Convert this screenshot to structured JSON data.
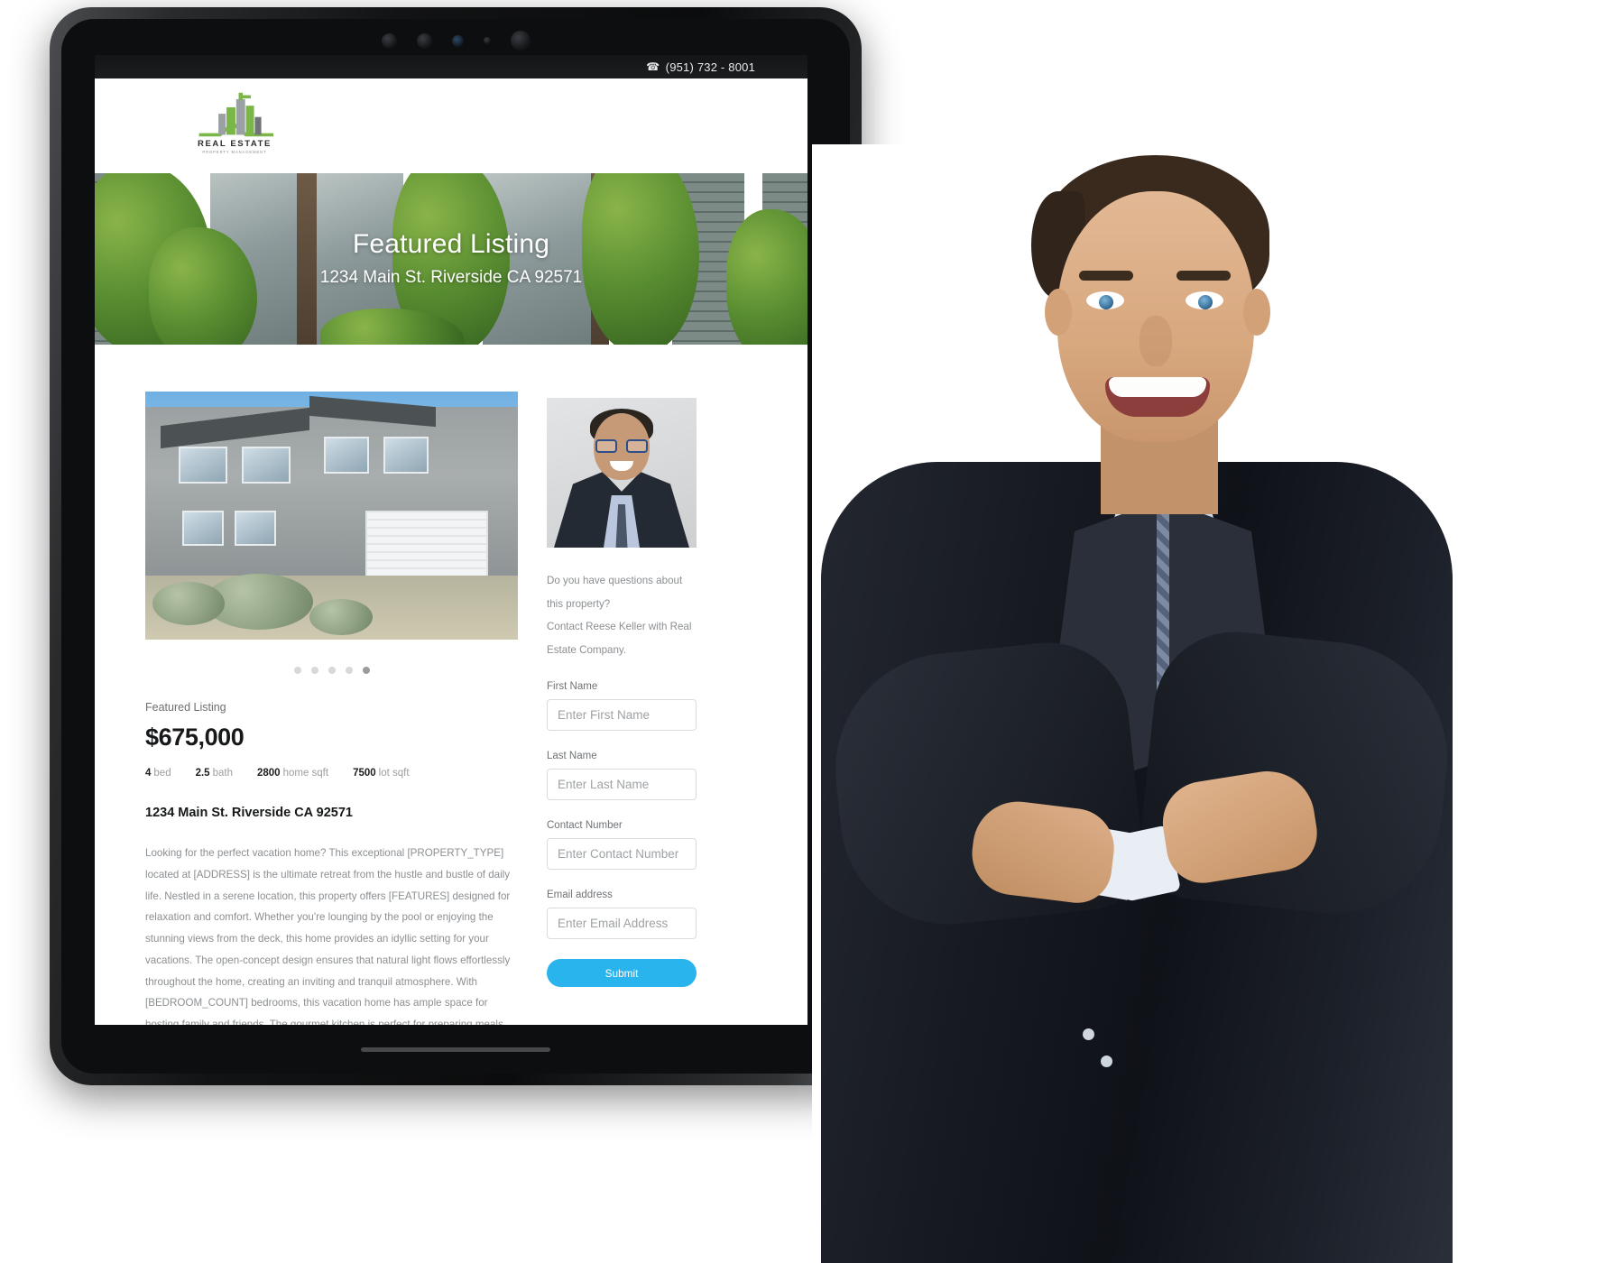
{
  "device": {
    "name": "tablet-mockup",
    "camera_icons": [
      "camera-icon",
      "sensor-icon",
      "lens-icon",
      "speaker-icon"
    ]
  },
  "site": {
    "topbar": {
      "phone": "(951) 732 - 8001",
      "phone_icon": "phone-icon"
    },
    "logo": {
      "title": "REAL ESTATE",
      "subtitle": "PROPERTY MANAGEMENT",
      "icon": "building-skyline-icon",
      "color": "#7ab648"
    }
  },
  "hero": {
    "title": "Featured Listing",
    "address": "1234 Main St. Riverside CA 92571"
  },
  "gallery": {
    "image_alt": "house-exterior-photo",
    "dots": [
      {
        "active": false
      },
      {
        "active": false
      },
      {
        "active": false
      },
      {
        "active": false
      },
      {
        "active": true
      }
    ]
  },
  "listing": {
    "eyebrow": "Featured Listing",
    "price": "$675,000",
    "specs": [
      {
        "value": "4",
        "label": "bed"
      },
      {
        "value": "2.5",
        "label": "bath"
      },
      {
        "value": "2800",
        "label": "home sqft"
      },
      {
        "value": "7500",
        "label": "lot sqft"
      }
    ],
    "address": "1234 Main St. Riverside CA 92571",
    "description": "Looking for the perfect vacation home? This exceptional [PROPERTY_TYPE] located at [ADDRESS] is the ultimate retreat from the hustle and bustle of daily life. Nestled in a serene location, this property offers [FEATURES] designed for relaxation and comfort. Whether you're lounging by the pool or enjoying the stunning views from the deck, this home provides an idyllic setting for your vacations. The open-concept design ensures that natural light flows effortlessly throughout the home, creating an inviting and tranquil atmosphere. With [BEDROOM_COUNT] bedrooms, this vacation home has ample space for hosting family and friends. The gourmet kitchen is perfect for preparing meals after a day of exploring the nearby attractions, while the outdoor areas are ideal for evening gatherings. Make your dream of owning a vacation home a reality—schedule a tour today to experience the peace and luxury this property offers."
  },
  "contact": {
    "agent_photo_alt": "agent-headshot",
    "intro_line1": "Do you have questions about this property?",
    "intro_line2": "Contact Reese Keller with Real Estate Company.",
    "fields": [
      {
        "label": "First Name",
        "placeholder": "Enter First Name",
        "value": ""
      },
      {
        "label": "Last Name",
        "placeholder": "Enter Last Name",
        "value": ""
      },
      {
        "label": "Contact Number",
        "placeholder": "Enter Contact Number",
        "value": ""
      },
      {
        "label": "Email address",
        "placeholder": "Enter Email Address",
        "value": ""
      }
    ],
    "submit_label": "Submit",
    "submit_color": "#2ab4ee"
  },
  "person": {
    "alt": "smiling-businessman-photo"
  }
}
